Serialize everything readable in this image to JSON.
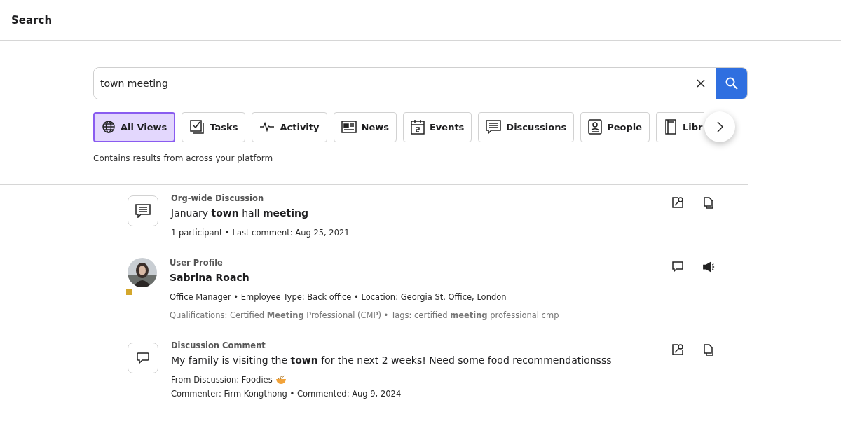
{
  "header": {
    "title": "Search"
  },
  "search": {
    "value": "town meeting"
  },
  "tabs": [
    {
      "label": "All Views",
      "kind": "globe",
      "selected": true
    },
    {
      "label": "Tasks",
      "kind": "tasks",
      "selected": false
    },
    {
      "label": "Activity",
      "kind": "pulse",
      "selected": false
    },
    {
      "label": "News",
      "kind": "news",
      "selected": false
    },
    {
      "label": "Events",
      "kind": "calendar",
      "selected": false
    },
    {
      "label": "Discussions",
      "kind": "chat",
      "selected": false
    },
    {
      "label": "People",
      "kind": "person",
      "selected": false
    },
    {
      "label": "Libr",
      "kind": "book",
      "selected": false
    }
  ],
  "tab_hint": "Contains results from across your platform",
  "results": [
    {
      "kind": "discussion",
      "type": "Org-wide Discussion",
      "title": "January **town** hall **meeting**",
      "lines": [
        {
          "text": "1 participant • Last comment: Aug 25, 2021",
          "muted": false,
          "kind": "plain"
        }
      ]
    },
    {
      "kind": "profile",
      "type": "User Profile",
      "title": "Sabrina Roach",
      "color": "#d4a72c",
      "lines": [
        {
          "text": "Office Manager • Employee Type: Back office • Location: Georgia St. Office, London",
          "muted": false,
          "kind": "plain"
        },
        {
          "text": "Qualifications: Certified **Meeting** Professional (CMP)  •  Tags: certified **meeting** professional cmp",
          "muted": true,
          "kind": "plain"
        }
      ]
    },
    {
      "kind": "comment",
      "type": "Discussion Comment",
      "title": "My family is visiting the **town** for the next 2 weeks! Need some food recommendationsss",
      "lines": [
        {
          "text": "From Discussion: Foodies",
          "muted": false,
          "kind": "bowl"
        },
        {
          "text": "Commenter: Firm Kongthong • Commented: Aug 9, 2024",
          "muted": false,
          "kind": "plain"
        }
      ]
    }
  ]
}
